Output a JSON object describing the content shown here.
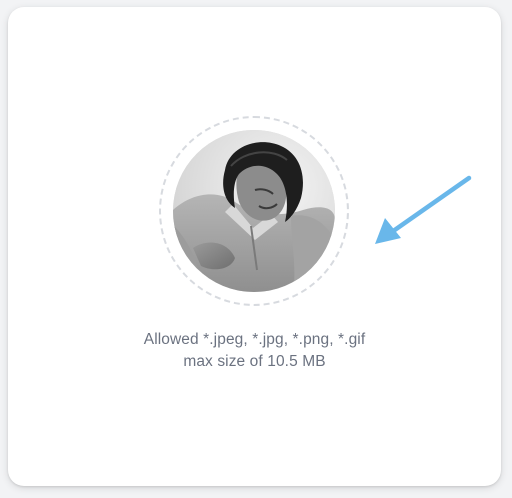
{
  "upload": {
    "allowed_text": "Allowed *.jpeg, *.jpg, *.png, *.gif",
    "max_size_text": "max size of 10.5 MB"
  },
  "colors": {
    "ring_border": "#d7dadf",
    "help_text": "#6b7280",
    "arrow": "#69b7ea",
    "card_background": "#ffffff"
  },
  "icons": {
    "annotation": "arrow-icon"
  }
}
